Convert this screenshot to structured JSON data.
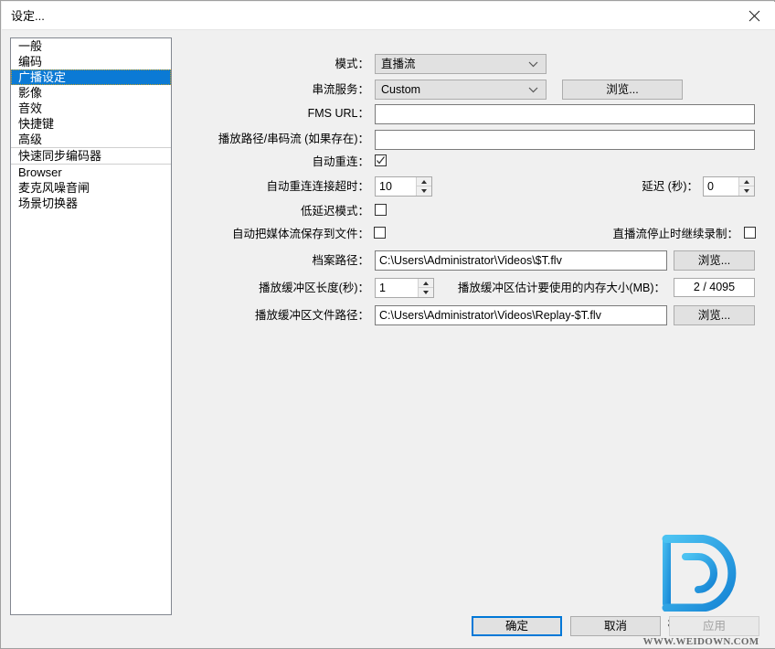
{
  "window": {
    "title": "设定...",
    "close_label": "×"
  },
  "sidebar": {
    "items": [
      {
        "label": "一般",
        "selected": false,
        "separator": "none"
      },
      {
        "label": "编码",
        "selected": false,
        "separator": "none"
      },
      {
        "label": "广播设定",
        "selected": true,
        "separator": "none"
      },
      {
        "label": "影像",
        "selected": false,
        "separator": "none"
      },
      {
        "label": "音效",
        "selected": false,
        "separator": "none"
      },
      {
        "label": "快捷键",
        "selected": false,
        "separator": "none"
      },
      {
        "label": "高级",
        "selected": false,
        "separator": "none"
      },
      {
        "label": "快速同步编码器",
        "selected": false,
        "separator": "top"
      },
      {
        "label": "Browser",
        "selected": false,
        "separator": "top"
      },
      {
        "label": "麦克风噪音闸",
        "selected": false,
        "separator": "none"
      },
      {
        "label": "场景切换器",
        "selected": false,
        "separator": "none"
      }
    ]
  },
  "form": {
    "mode": {
      "label": "模式：",
      "value": "直播流"
    },
    "stream_service": {
      "label": "串流服务：",
      "value": "Custom",
      "browse_label": "浏览..."
    },
    "fms_url": {
      "label": "FMS URL：",
      "value": ""
    },
    "play_path": {
      "label": "播放路径/串码流 (如果存在)：",
      "value": ""
    },
    "auto_reconnect": {
      "label": "自动重连：",
      "checked": true
    },
    "reconnect_timeout": {
      "label": "自动重连连接超时：",
      "value": "10"
    },
    "delay_seconds": {
      "label": "延迟 (秒)：",
      "value": "0"
    },
    "low_latency": {
      "label": "低延迟模式：",
      "checked": false
    },
    "auto_save_stream": {
      "label": "自动把媒体流保存到文件：",
      "checked": false
    },
    "keep_recording": {
      "label": "直播流停止时继续录制：",
      "checked": false
    },
    "file_path": {
      "label": "档案路径：",
      "value": "C:\\Users\\Administrator\\Videos\\$T.flv",
      "browse_label": "浏览..."
    },
    "buffer_length": {
      "label": "播放缓冲区长度(秒)：",
      "value": "1"
    },
    "buffer_memory": {
      "label": "播放缓冲区估计要使用的内存大小(MB)：",
      "value": "2 / 4095"
    },
    "buffer_file_path": {
      "label": "播放缓冲区文件路径：",
      "value": "C:\\Users\\Administrator\\Videos\\Replay-$T.flv",
      "browse_label": "浏览..."
    }
  },
  "footer": {
    "ok_label": "确定",
    "cancel_label": "取消",
    "apply_label": "应用"
  },
  "watermark": {
    "name": "微当下载",
    "url": "WWW.WEIDOWN.COM"
  },
  "colors": {
    "selection_blue": "#0b7ad5",
    "focus_blue": "#0078d7",
    "dialog_bg": "#f0f0f0",
    "logo_blue": "#1f9ae0",
    "logo_blue_light": "#49c2f0"
  }
}
